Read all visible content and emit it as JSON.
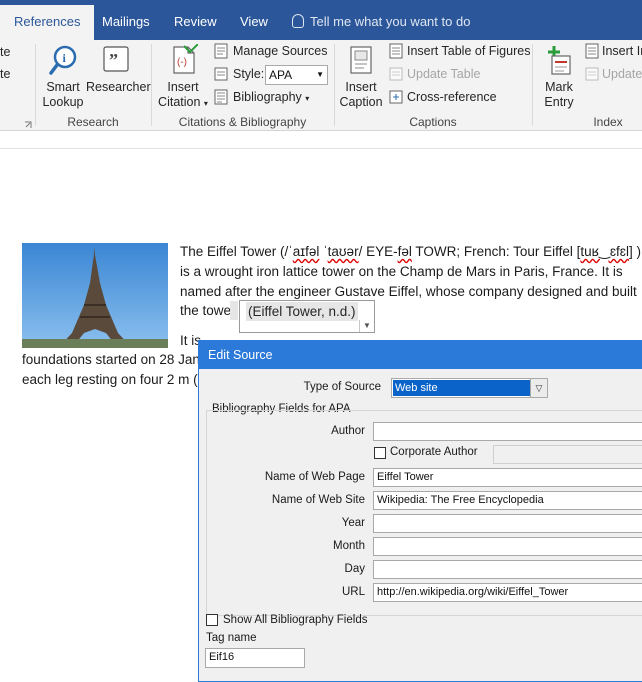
{
  "tabs": [
    {
      "label": "References",
      "active": true
    },
    {
      "label": "Mailings",
      "active": false
    },
    {
      "label": "Review",
      "active": false
    },
    {
      "label": "View",
      "active": false
    }
  ],
  "tell_me": "Tell me what you want to do",
  "ribbon": {
    "partial_left": [
      "te",
      "te"
    ],
    "research": {
      "smart_lookup": [
        "Smart",
        "Lookup"
      ],
      "researcher": "Researcher",
      "group_label": "Research"
    },
    "citations": {
      "insert_citation": [
        "Insert",
        "Citation"
      ],
      "manage_sources": "Manage Sources",
      "style_label": "Style:",
      "style_value": "APA",
      "bibliography": "Bibliography",
      "group_label": "Citations & Bibliography"
    },
    "captions": {
      "insert_caption": [
        "Insert",
        "Caption"
      ],
      "insert_table_of_figures": "Insert Table of Figures",
      "update_table": "Update Table",
      "cross_reference": "Cross-reference",
      "group_label": "Captions"
    },
    "index": {
      "mark_entry": [
        "Mark",
        "Entry"
      ],
      "insert_index": "Insert In",
      "update_index": "Update",
      "group_label": "Index"
    }
  },
  "document": {
    "lines": [
      "The Eiffel Tower (/ˈaɪfəl ˈtaʊər/ EYE-fəl TOWR; French: Tour Eiffel [tuʁ‿ɛfɛl] )",
      "is a wrought iron lattice tower on the Champ de Mars in Paris, France. It is",
      "named after the engineer Gustave Eiffel, whose company designed and built",
      "the towe"
    ],
    "citation": "(Eiffel Tower, n.d.)",
    "line5": "It is",
    "line6": "foundations started on 28 Jan",
    "line7": "each leg resting on four 2 m ("
  },
  "dialog": {
    "title": "Edit Source",
    "type_of_source_label": "Type of Source",
    "type_of_source_value": "Web site",
    "fields_group_label": "Bibliography Fields for APA",
    "author_label": "Author",
    "author_value": "",
    "corporate_author_label": "Corporate Author",
    "web_page_label": "Name of Web Page",
    "web_page_value": "Eiffel Tower",
    "web_site_label": "Name of Web Site",
    "web_site_value": "Wikipedia: The Free Encyclopedia",
    "year_label": "Year",
    "month_label": "Month",
    "day_label": "Day",
    "url_label": "URL",
    "url_value": "http://en.wikipedia.org/wiki/Eiffel_Tower",
    "show_all_label": "Show All Bibliography Fields",
    "tag_name_label": "Tag name",
    "tag_name_value": "Eif16"
  },
  "colors": {
    "tab_bar": "#2b579a",
    "ribbon_bg": "#f3f3f3",
    "dialog_title": "#2b79d8",
    "selection": "#0a63c9"
  }
}
